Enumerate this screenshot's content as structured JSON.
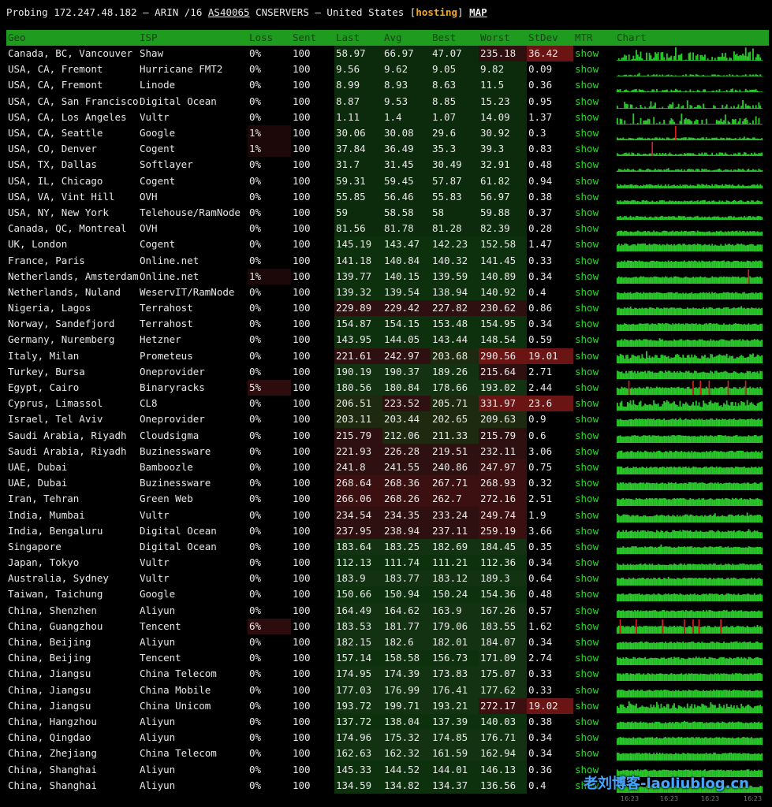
{
  "header": {
    "prefix": "Probing 172.247.48.182 — ARIN /16",
    "asn": "AS40065",
    "org": "CNSERVERS — United States",
    "bracket_open": "[",
    "hosting": "hosting",
    "bracket_close": "]",
    "map": "MAP"
  },
  "columns": [
    "Geo",
    "ISP",
    "Loss",
    "Sent",
    "Last",
    "Avg",
    "Best",
    "Worst",
    "StDev",
    "MTR",
    "Chart"
  ],
  "colors": {
    "header_bg": "#1f9b1f",
    "show_link": "#2bd82b",
    "chart_bar": "#2bc62b",
    "chart_spike": "#e02020",
    "watermark": "#46a6ff"
  },
  "rows": [
    {
      "geo": "Canada, BC, Vancouver",
      "isp": "Shaw",
      "loss": "0%",
      "sent": "100",
      "last": "58.97",
      "avg": "66.97",
      "best": "47.07",
      "worst": "235.18",
      "stdev": "36.42",
      "mtr": "show"
    },
    {
      "geo": "USA, CA, Fremont",
      "isp": "Hurricane FMT2",
      "loss": "0%",
      "sent": "100",
      "last": "9.56",
      "avg": "9.62",
      "best": "9.05",
      "worst": "9.82",
      "stdev": "0.09",
      "mtr": "show"
    },
    {
      "geo": "USA, CA, Fremont",
      "isp": "Linode",
      "loss": "0%",
      "sent": "100",
      "last": "8.99",
      "avg": "8.93",
      "best": "8.63",
      "worst": "11.5",
      "stdev": "0.36",
      "mtr": "show"
    },
    {
      "geo": "USA, CA, San Francisco",
      "isp": "Digital Ocean",
      "loss": "0%",
      "sent": "100",
      "last": "8.87",
      "avg": "9.53",
      "best": "8.85",
      "worst": "15.23",
      "stdev": "0.95",
      "mtr": "show"
    },
    {
      "geo": "USA, CA, Los Angeles",
      "isp": "Vultr",
      "loss": "0%",
      "sent": "100",
      "last": "1.11",
      "avg": "1.4",
      "best": "1.07",
      "worst": "14.09",
      "stdev": "1.37",
      "mtr": "show"
    },
    {
      "geo": "USA, CA, Seattle",
      "isp": "Google",
      "loss": "1%",
      "sent": "100",
      "last": "30.06",
      "avg": "30.08",
      "best": "29.6",
      "worst": "30.92",
      "stdev": "0.3",
      "mtr": "show"
    },
    {
      "geo": "USA, CO, Denver",
      "isp": "Cogent",
      "loss": "1%",
      "sent": "100",
      "last": "37.84",
      "avg": "36.49",
      "best": "35.3",
      "worst": "39.3",
      "stdev": "0.83",
      "mtr": "show"
    },
    {
      "geo": "USA, TX, Dallas",
      "isp": "Softlayer",
      "loss": "0%",
      "sent": "100",
      "last": "31.7",
      "avg": "31.45",
      "best": "30.49",
      "worst": "32.91",
      "stdev": "0.48",
      "mtr": "show"
    },
    {
      "geo": "USA, IL, Chicago",
      "isp": "Cogent",
      "loss": "0%",
      "sent": "100",
      "last": "59.31",
      "avg": "59.45",
      "best": "57.87",
      "worst": "61.82",
      "stdev": "0.94",
      "mtr": "show"
    },
    {
      "geo": "USA, VA, Vint Hill",
      "isp": "OVH",
      "loss": "0%",
      "sent": "100",
      "last": "55.85",
      "avg": "56.46",
      "best": "55.83",
      "worst": "56.97",
      "stdev": "0.38",
      "mtr": "show"
    },
    {
      "geo": "USA, NY, New York",
      "isp": "Telehouse/RamNode",
      "loss": "0%",
      "sent": "100",
      "last": "59",
      "avg": "58.58",
      "best": "58",
      "worst": "59.88",
      "stdev": "0.37",
      "mtr": "show"
    },
    {
      "geo": "Canada, QC, Montreal",
      "isp": "OVH",
      "loss": "0%",
      "sent": "100",
      "last": "81.56",
      "avg": "81.78",
      "best": "81.28",
      "worst": "82.39",
      "stdev": "0.28",
      "mtr": "show"
    },
    {
      "geo": "UK, London",
      "isp": "Cogent",
      "loss": "0%",
      "sent": "100",
      "last": "145.19",
      "avg": "143.47",
      "best": "142.23",
      "worst": "152.58",
      "stdev": "1.47",
      "mtr": "show"
    },
    {
      "geo": "France, Paris",
      "isp": "Online.net",
      "loss": "0%",
      "sent": "100",
      "last": "141.18",
      "avg": "140.84",
      "best": "140.32",
      "worst": "141.45",
      "stdev": "0.33",
      "mtr": "show"
    },
    {
      "geo": "Netherlands, Amsterdam",
      "isp": "Online.net",
      "loss": "1%",
      "sent": "100",
      "last": "139.77",
      "avg": "140.15",
      "best": "139.59",
      "worst": "140.89",
      "stdev": "0.34",
      "mtr": "show"
    },
    {
      "geo": "Netherlands, Nuland",
      "isp": "WeservIT/RamNode",
      "loss": "0%",
      "sent": "100",
      "last": "139.32",
      "avg": "139.54",
      "best": "138.94",
      "worst": "140.92",
      "stdev": "0.4",
      "mtr": "show"
    },
    {
      "geo": "Nigeria, Lagos",
      "isp": "Terrahost",
      "loss": "0%",
      "sent": "100",
      "last": "229.89",
      "avg": "229.42",
      "best": "227.82",
      "worst": "230.62",
      "stdev": "0.86",
      "mtr": "show"
    },
    {
      "geo": "Norway, Sandefjord",
      "isp": "Terrahost",
      "loss": "0%",
      "sent": "100",
      "last": "154.87",
      "avg": "154.15",
      "best": "153.48",
      "worst": "154.95",
      "stdev": "0.34",
      "mtr": "show"
    },
    {
      "geo": "Germany, Nuremberg",
      "isp": "Hetzner",
      "loss": "0%",
      "sent": "100",
      "last": "143.95",
      "avg": "144.05",
      "best": "143.44",
      "worst": "148.54",
      "stdev": "0.59",
      "mtr": "show"
    },
    {
      "geo": "Italy, Milan",
      "isp": "Prometeus",
      "loss": "0%",
      "sent": "100",
      "last": "221.61",
      "avg": "242.97",
      "best": "203.68",
      "worst": "290.56",
      "stdev": "19.01",
      "mtr": "show"
    },
    {
      "geo": "Turkey, Bursa",
      "isp": "Oneprovider",
      "loss": "0%",
      "sent": "100",
      "last": "190.19",
      "avg": "190.37",
      "best": "189.26",
      "worst": "215.64",
      "stdev": "2.71",
      "mtr": "show"
    },
    {
      "geo": "Egypt, Cairo",
      "isp": "Binaryracks",
      "loss": "5%",
      "sent": "100",
      "last": "180.56",
      "avg": "180.84",
      "best": "178.66",
      "worst": "193.02",
      "stdev": "2.44",
      "mtr": "show"
    },
    {
      "geo": "Cyprus, Limassol",
      "isp": "CL8",
      "loss": "0%",
      "sent": "100",
      "last": "206.51",
      "avg": "223.52",
      "best": "205.71",
      "worst": "331.97",
      "stdev": "23.6",
      "mtr": "show"
    },
    {
      "geo": "Israel, Tel Aviv",
      "isp": "Oneprovider",
      "loss": "0%",
      "sent": "100",
      "last": "203.11",
      "avg": "203.44",
      "best": "202.65",
      "worst": "209.63",
      "stdev": "0.9",
      "mtr": "show"
    },
    {
      "geo": "Saudi Arabia, Riyadh",
      "isp": "Cloudsigma",
      "loss": "0%",
      "sent": "100",
      "last": "215.79",
      "avg": "212.06",
      "best": "211.33",
      "worst": "215.79",
      "stdev": "0.6",
      "mtr": "show"
    },
    {
      "geo": "Saudi Arabia, Riyadh",
      "isp": "Buzinessware",
      "loss": "0%",
      "sent": "100",
      "last": "221.93",
      "avg": "226.28",
      "best": "219.51",
      "worst": "232.11",
      "stdev": "3.06",
      "mtr": "show"
    },
    {
      "geo": "UAE, Dubai",
      "isp": "Bamboozle",
      "loss": "0%",
      "sent": "100",
      "last": "241.8",
      "avg": "241.55",
      "best": "240.86",
      "worst": "247.97",
      "stdev": "0.75",
      "mtr": "show"
    },
    {
      "geo": "UAE, Dubai",
      "isp": "Buzinessware",
      "loss": "0%",
      "sent": "100",
      "last": "268.64",
      "avg": "268.36",
      "best": "267.71",
      "worst": "268.93",
      "stdev": "0.32",
      "mtr": "show"
    },
    {
      "geo": "Iran, Tehran",
      "isp": "Green Web",
      "loss": "0%",
      "sent": "100",
      "last": "266.06",
      "avg": "268.26",
      "best": "262.7",
      "worst": "272.16",
      "stdev": "2.51",
      "mtr": "show"
    },
    {
      "geo": "India, Mumbai",
      "isp": "Vultr",
      "loss": "0%",
      "sent": "100",
      "last": "234.54",
      "avg": "234.35",
      "best": "233.24",
      "worst": "249.74",
      "stdev": "1.9",
      "mtr": "show"
    },
    {
      "geo": "India, Bengaluru",
      "isp": "Digital Ocean",
      "loss": "0%",
      "sent": "100",
      "last": "237.95",
      "avg": "238.94",
      "best": "237.11",
      "worst": "259.19",
      "stdev": "3.66",
      "mtr": "show"
    },
    {
      "geo": "Singapore",
      "isp": "Digital Ocean",
      "loss": "0%",
      "sent": "100",
      "last": "183.64",
      "avg": "183.25",
      "best": "182.69",
      "worst": "184.45",
      "stdev": "0.35",
      "mtr": "show"
    },
    {
      "geo": "Japan, Tokyo",
      "isp": "Vultr",
      "loss": "0%",
      "sent": "100",
      "last": "112.13",
      "avg": "111.74",
      "best": "111.21",
      "worst": "112.36",
      "stdev": "0.34",
      "mtr": "show"
    },
    {
      "geo": "Australia, Sydney",
      "isp": "Vultr",
      "loss": "0%",
      "sent": "100",
      "last": "183.9",
      "avg": "183.77",
      "best": "183.12",
      "worst": "189.3",
      "stdev": "0.64",
      "mtr": "show"
    },
    {
      "geo": "Taiwan, Taichung",
      "isp": "Google",
      "loss": "0%",
      "sent": "100",
      "last": "150.66",
      "avg": "150.94",
      "best": "150.24",
      "worst": "154.36",
      "stdev": "0.48",
      "mtr": "show"
    },
    {
      "geo": "China, Shenzhen",
      "isp": "Aliyun",
      "loss": "0%",
      "sent": "100",
      "last": "164.49",
      "avg": "164.62",
      "best": "163.9",
      "worst": "167.26",
      "stdev": "0.57",
      "mtr": "show"
    },
    {
      "geo": "China, Guangzhou",
      "isp": "Tencent",
      "loss": "6%",
      "sent": "100",
      "last": "183.53",
      "avg": "181.77",
      "best": "179.06",
      "worst": "183.55",
      "stdev": "1.62",
      "mtr": "show"
    },
    {
      "geo": "China, Beijing",
      "isp": "Aliyun",
      "loss": "0%",
      "sent": "100",
      "last": "182.15",
      "avg": "182.6",
      "best": "182.01",
      "worst": "184.07",
      "stdev": "0.34",
      "mtr": "show"
    },
    {
      "geo": "China, Beijing",
      "isp": "Tencent",
      "loss": "0%",
      "sent": "100",
      "last": "157.14",
      "avg": "158.58",
      "best": "156.73",
      "worst": "171.09",
      "stdev": "2.74",
      "mtr": "show"
    },
    {
      "geo": "China, Jiangsu",
      "isp": "China Telecom",
      "loss": "0%",
      "sent": "100",
      "last": "174.95",
      "avg": "174.39",
      "best": "173.83",
      "worst": "175.07",
      "stdev": "0.33",
      "mtr": "show"
    },
    {
      "geo": "China, Jiangsu",
      "isp": "China Mobile",
      "loss": "0%",
      "sent": "100",
      "last": "177.03",
      "avg": "176.99",
      "best": "176.41",
      "worst": "177.62",
      "stdev": "0.33",
      "mtr": "show"
    },
    {
      "geo": "China, Jiangsu",
      "isp": "China Unicom",
      "loss": "0%",
      "sent": "100",
      "last": "193.72",
      "avg": "199.71",
      "best": "193.21",
      "worst": "272.17",
      "stdev": "19.02",
      "mtr": "show"
    },
    {
      "geo": "China, Hangzhou",
      "isp": "Aliyun",
      "loss": "0%",
      "sent": "100",
      "last": "137.72",
      "avg": "138.04",
      "best": "137.39",
      "worst": "140.03",
      "stdev": "0.38",
      "mtr": "show"
    },
    {
      "geo": "China, Qingdao",
      "isp": "Aliyun",
      "loss": "0%",
      "sent": "100",
      "last": "174.96",
      "avg": "175.32",
      "best": "174.85",
      "worst": "176.71",
      "stdev": "0.34",
      "mtr": "show"
    },
    {
      "geo": "China, Zhejiang",
      "isp": "China Telecom",
      "loss": "0%",
      "sent": "100",
      "last": "162.63",
      "avg": "162.32",
      "best": "161.59",
      "worst": "162.94",
      "stdev": "0.34",
      "mtr": "show"
    },
    {
      "geo": "China, Shanghai",
      "isp": "Aliyun",
      "loss": "0%",
      "sent": "100",
      "last": "145.33",
      "avg": "144.52",
      "best": "144.01",
      "worst": "146.13",
      "stdev": "0.36",
      "mtr": "show"
    },
    {
      "geo": "China, Shanghai",
      "isp": "Aliyun",
      "loss": "0%",
      "sent": "100",
      "last": "134.59",
      "avg": "134.82",
      "best": "134.37",
      "worst": "136.56",
      "stdev": "0.4",
      "mtr": "show"
    }
  ],
  "watermark": "老刘博客-laoliublog.cn",
  "chart_time_ticks": [
    "16:23",
    "16:23",
    "16:23",
    "16:23"
  ]
}
